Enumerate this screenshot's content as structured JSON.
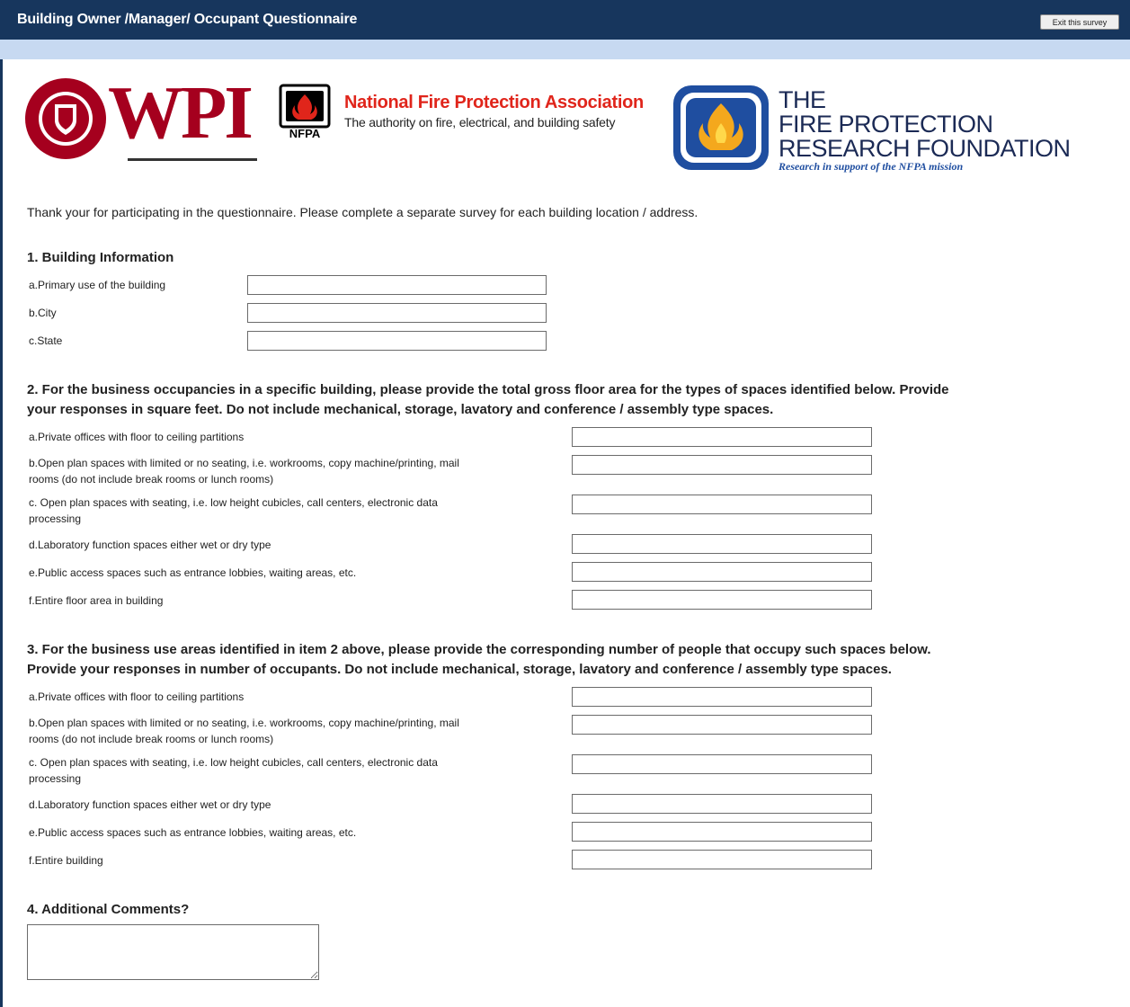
{
  "header": {
    "title": "Building Owner /Manager/ Occupant Questionnaire",
    "exit_label": "Exit this survey"
  },
  "logos": {
    "wpi": "WPI",
    "nfpa_abbr": "NFPA",
    "nfpa_title": "National Fire Protection Association",
    "nfpa_tagline": "The authority on fire, electrical, and building safety",
    "fprf_line1": "THE",
    "fprf_line2": "FIRE PROTECTION",
    "fprf_line3": "RESEARCH FOUNDATION",
    "fprf_tagline": "Research in support of the NFPA mission"
  },
  "intro": "Thank your for participating in the questionnaire. Please complete a separate survey for each building location / address.",
  "q1": {
    "title": "1. Building Information",
    "rows": [
      {
        "label": "a.Primary use of the building",
        "value": ""
      },
      {
        "label": "b.City",
        "value": ""
      },
      {
        "label": "c.State",
        "value": ""
      }
    ]
  },
  "q2": {
    "title_line1": "2. For the business occupancies in a specific building, please provide the total gross floor area for the types of spaces identified below. Provide",
    "title_line2": "your responses in square feet. Do not include mechanical, storage, lavatory and conference / assembly type spaces.",
    "rows": [
      {
        "label": "a.Private offices with floor to ceiling partitions",
        "value": ""
      },
      {
        "label_line1": "b.Open plan spaces with limited or no seating, i.e. workrooms, copy machine/printing, mail",
        "label_line2": "rooms (do not include break rooms or lunch rooms)",
        "value": ""
      },
      {
        "label_line1": "c. Open plan spaces with seating, i.e. low height cubicles, call centers, electronic data",
        "label_line2": "processing",
        "value": ""
      },
      {
        "label": "d.Laboratory function spaces either wet or dry type",
        "value": ""
      },
      {
        "label": "e.Public access spaces such as entrance lobbies, waiting areas, etc.",
        "value": ""
      },
      {
        "label": "f.Entire floor area in building",
        "value": ""
      }
    ]
  },
  "q3": {
    "title_line1": "3. For the business use areas identified in item 2 above, please provide the corresponding number of people that occupy such spaces below.",
    "title_line2": "Provide your responses in number of occupants. Do not include mechanical, storage, lavatory and conference / assembly type spaces.",
    "rows": [
      {
        "label": "a.Private offices with floor to ceiling partitions",
        "value": ""
      },
      {
        "label_line1": "b.Open plan spaces with limited or no seating, i.e. workrooms, copy machine/printing, mail",
        "label_line2": "rooms (do not include break rooms or lunch rooms)",
        "value": ""
      },
      {
        "label_line1": "c. Open plan spaces with seating, i.e. low height cubicles, call centers, electronic data",
        "label_line2": "processing",
        "value": ""
      },
      {
        "label": "d.Laboratory function spaces either wet or dry type",
        "value": ""
      },
      {
        "label": "e.Public access spaces such as entrance lobbies, waiting areas, etc.",
        "value": ""
      },
      {
        "label": "f.Entire building",
        "value": ""
      }
    ]
  },
  "q4": {
    "title": "4. Additional Comments?",
    "value": ""
  },
  "colors": {
    "header_bg": "#17365d",
    "subbar_bg": "#c7d9f1",
    "wpi_red": "#a5001e",
    "nfpa_red": "#e0251b",
    "fprf_blue": "#1f4ea0"
  }
}
